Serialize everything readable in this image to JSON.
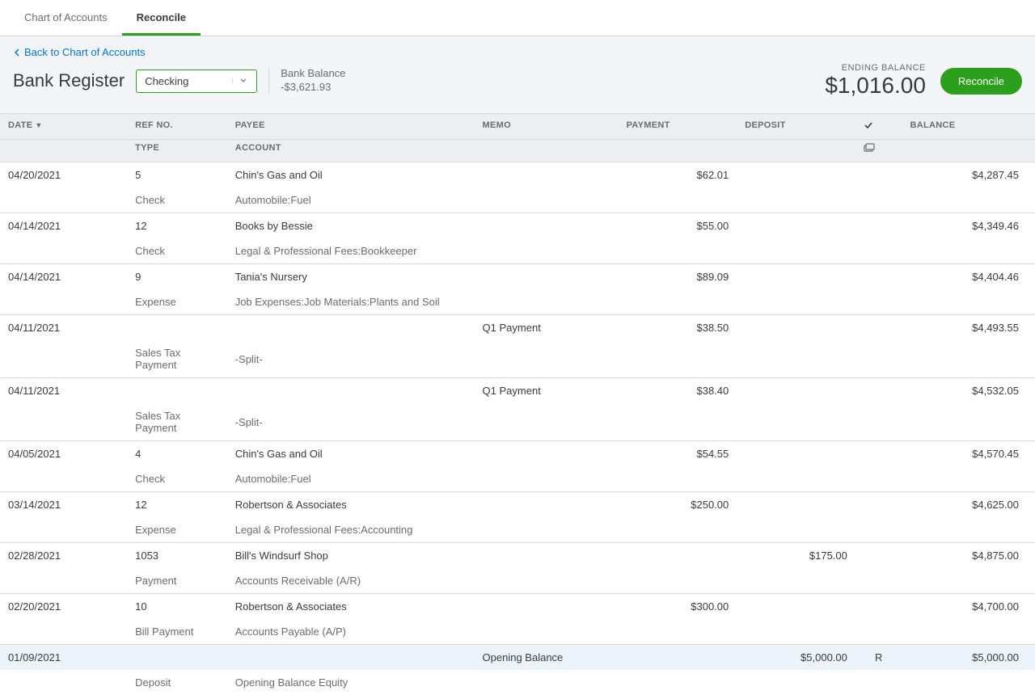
{
  "tabs": {
    "chart": "Chart of Accounts",
    "reconcile": "Reconcile"
  },
  "backLink": "Back to Chart of Accounts",
  "pageTitle": "Bank Register",
  "accountSelect": "Checking",
  "bankBalanceLabel": "Bank Balance",
  "bankBalanceValue": "-$3,621.93",
  "endingBalanceLabel": "ENDING BALANCE",
  "endingBalanceValue": "$1,016.00",
  "reconcileBtn": "Reconcile",
  "columns": {
    "date": "DATE",
    "ref": "REF NO.",
    "type": "TYPE",
    "payee": "PAYEE",
    "account": "ACCOUNT",
    "memo": "MEMO",
    "payment": "PAYMENT",
    "deposit": "DEPOSIT",
    "balance": "BALANCE"
  },
  "rows": [
    {
      "date": "04/20/2021",
      "ref": "5",
      "type": "Check",
      "payee": "Chin's Gas and Oil",
      "account": "Automobile:Fuel",
      "memo": "",
      "payment": "$62.01",
      "deposit": "",
      "rec": "",
      "balance": "$4,287.45",
      "sel": false
    },
    {
      "date": "04/14/2021",
      "ref": "12",
      "type": "Check",
      "payee": "Books by Bessie",
      "account": "Legal & Professional Fees:Bookkeeper",
      "memo": "",
      "payment": "$55.00",
      "deposit": "",
      "rec": "",
      "balance": "$4,349.46",
      "sel": false
    },
    {
      "date": "04/14/2021",
      "ref": "9",
      "type": "Expense",
      "payee": "Tania's Nursery",
      "account": "Job Expenses:Job Materials:Plants and Soil",
      "memo": "",
      "payment": "$89.09",
      "deposit": "",
      "rec": "",
      "balance": "$4,404.46",
      "sel": false
    },
    {
      "date": "04/11/2021",
      "ref": "",
      "type": "Sales Tax Payment",
      "payee": "",
      "account": "-Split-",
      "memo": "Q1 Payment",
      "payment": "$38.50",
      "deposit": "",
      "rec": "",
      "balance": "$4,493.55",
      "sel": false
    },
    {
      "date": "04/11/2021",
      "ref": "",
      "type": "Sales Tax Payment",
      "payee": "",
      "account": "-Split-",
      "memo": "Q1 Payment",
      "payment": "$38.40",
      "deposit": "",
      "rec": "",
      "balance": "$4,532.05",
      "sel": false
    },
    {
      "date": "04/05/2021",
      "ref": "4",
      "type": "Check",
      "payee": "Chin's Gas and Oil",
      "account": "Automobile:Fuel",
      "memo": "",
      "payment": "$54.55",
      "deposit": "",
      "rec": "",
      "balance": "$4,570.45",
      "sel": false
    },
    {
      "date": "03/14/2021",
      "ref": "12",
      "type": "Expense",
      "payee": "Robertson & Associates",
      "account": "Legal & Professional Fees:Accounting",
      "memo": "",
      "payment": "$250.00",
      "deposit": "",
      "rec": "",
      "balance": "$4,625.00",
      "sel": false
    },
    {
      "date": "02/28/2021",
      "ref": "1053",
      "type": "Payment",
      "payee": "Bill's Windsurf Shop",
      "account": "Accounts Receivable (A/R)",
      "memo": "",
      "payment": "",
      "deposit": "$175.00",
      "rec": "",
      "balance": "$4,875.00",
      "sel": false
    },
    {
      "date": "02/20/2021",
      "ref": "10",
      "type": "Bill Payment",
      "payee": "Robertson & Associates",
      "account": "Accounts Payable (A/P)",
      "memo": "",
      "payment": "$300.00",
      "deposit": "",
      "rec": "",
      "balance": "$4,700.00",
      "sel": false
    },
    {
      "date": "01/09/2021",
      "ref": "",
      "type": "Deposit",
      "payee": "",
      "account": "Opening Balance Equity",
      "memo": "Opening Balance",
      "payment": "",
      "deposit": "$5,000.00",
      "rec": "R",
      "balance": "$5,000.00",
      "sel": true
    }
  ]
}
